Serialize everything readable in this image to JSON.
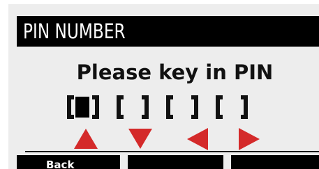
{
  "header": {
    "title": "PIN NUMBER"
  },
  "prompt": {
    "text": "Please key in PIN"
  },
  "pin": {
    "slots": [
      {
        "value": "",
        "active": true
      },
      {
        "value": "",
        "active": false
      },
      {
        "value": "",
        "active": false
      },
      {
        "value": "",
        "active": false
      }
    ]
  },
  "nav": {
    "icons": [
      "arrow-up-icon",
      "arrow-down-icon",
      "arrow-left-icon",
      "arrow-right-icon"
    ],
    "color": "#d42a2a"
  },
  "softkeys": {
    "key1_label": "Back",
    "key2_label": "",
    "key3_label": ""
  }
}
